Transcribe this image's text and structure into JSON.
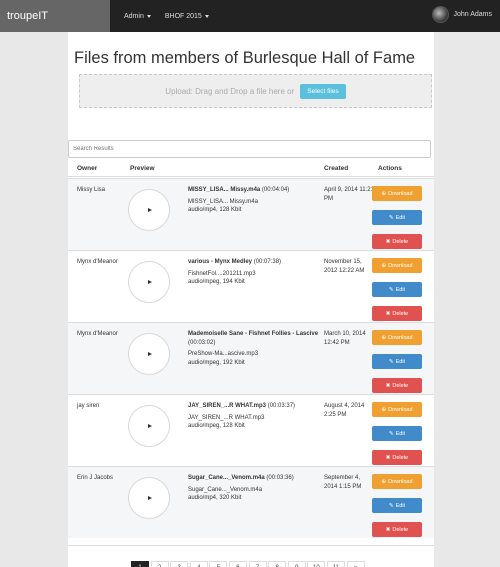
{
  "navbar": {
    "brand": "troupeIT",
    "menus": [
      {
        "label": "Admin"
      },
      {
        "label": "BHOF 2015"
      }
    ],
    "user": "John Adams"
  },
  "page": {
    "title": "Files from members of Burlesque Hall of Fame",
    "upload_text": "Upload: Drag and Drop a file here or",
    "select_label": "Select files",
    "search_placeholder": "Search Results"
  },
  "table": {
    "headers": {
      "owner": "Owner",
      "preview": "Preview",
      "created": "Created",
      "actions": "Actions"
    },
    "actions": {
      "download": "Download",
      "edit": "Edit",
      "delete": "Delete"
    },
    "rows": [
      {
        "owner": "Missy Lisa",
        "title": "MISSY_LISA... Missy.m4a",
        "duration": "(00:04:04)",
        "filename": "MISSY_LISA... Missy.m4a",
        "meta": "audio/mp4, 128 Kbit",
        "created": "April 9, 2014 11:21 PM"
      },
      {
        "owner": "Mynx d'Meanor",
        "title": "various - Mynx Medley",
        "duration": "(00:07:38)",
        "filename": "FishnetFol....201211.mp3",
        "meta": "audio/mpeg, 194 Kbit",
        "created": "November 15, 2012 12:22 AM"
      },
      {
        "owner": "Mynx d'Meanor",
        "title": "Mademoiselle Sane - Fishnet Follies - Lascive",
        "duration": "(00:03:02)",
        "filename": "PreShow-Ma...ascive.mp3",
        "meta": "audio/mpeg, 192 Kbit",
        "created": "March 10, 2014 12:42 PM"
      },
      {
        "owner": "jay siren",
        "title": "JAY_SIREN_...R WHAT.mp3",
        "duration": "(00:03:37)",
        "filename": "JAY_SIREN_...R WHAT.mp3",
        "meta": "audio/mpeg, 128 Kbit",
        "created": "August 4, 2014 2:25 PM"
      },
      {
        "owner": "Erin J Jacobs",
        "title": "Sugar_Cane..._Venom.m4a",
        "duration": "(00:03:36)",
        "filename": "Sugar_Cane..._Venom.m4a",
        "meta": "audio/mp4, 320 Kbit",
        "created": "September 4, 2014 1:15 PM"
      }
    ]
  },
  "pagination": [
    "1",
    "2",
    "3",
    "4",
    "5",
    "6",
    "7",
    "8",
    "9",
    "10",
    "11",
    "»"
  ],
  "pagination_active": "1",
  "colors": {
    "navbar": "#222222",
    "brand_bg": "#666666",
    "download": "#f0a030",
    "edit": "#428bca",
    "delete": "#e0524f",
    "select_files": "#5bc0de"
  }
}
